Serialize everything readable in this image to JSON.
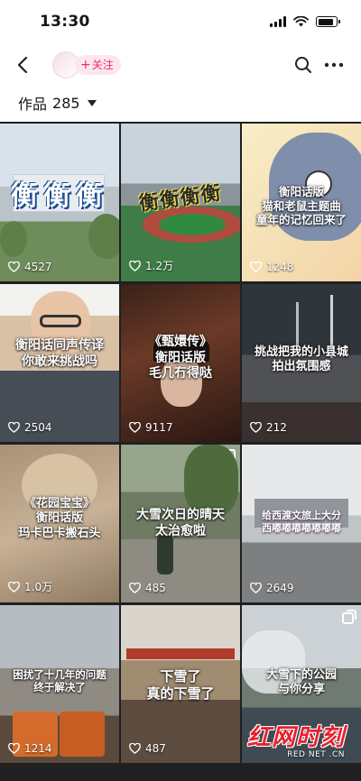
{
  "status_bar": {
    "time": "13:30"
  },
  "nav": {
    "follow_label": "关注"
  },
  "works": {
    "label": "作品",
    "count": "285"
  },
  "tiles": [
    {
      "overlay": "衡衡衡",
      "caption": "",
      "likes": "4527",
      "pinned": false
    },
    {
      "overlay": "衡衡衡衡",
      "caption": "",
      "likes": "1.2万",
      "pinned": false
    },
    {
      "overlay": "",
      "caption": "衡阳话版\n猫和老鼠主题曲\n童年的记忆回来了",
      "likes": "1248",
      "pinned": false
    },
    {
      "overlay": "",
      "caption": "衡阳话同声传译\n你敢来挑战吗",
      "likes": "2504",
      "pinned": false
    },
    {
      "overlay": "",
      "caption": "《甄嬛传》\n衡阳话版\n毛几冇得哒",
      "likes": "9117",
      "pinned": false
    },
    {
      "overlay": "",
      "caption": "挑战把我的小县城\n拍出氛围感",
      "likes": "212",
      "pinned": false
    },
    {
      "overlay": "",
      "caption": "《花园宝宝》\n衡阳话版\n玛卡巴卡搬石头",
      "likes": "1.0万",
      "pinned": false
    },
    {
      "overlay": "",
      "caption": "大雪次日的晴天\n太治愈啦",
      "likes": "485",
      "pinned": true
    },
    {
      "overlay": "",
      "caption": "给西渡文旅上大分\n西嘟嘟嘟嘟嘟嘟嘟",
      "likes": "2649",
      "pinned": false
    },
    {
      "overlay": "",
      "caption": "困扰了十几年的问题\n终于解决了",
      "likes": "1214",
      "pinned": false
    },
    {
      "overlay": "",
      "caption": "下雪了\n真的下雪了",
      "likes": "487",
      "pinned": false
    },
    {
      "overlay": "",
      "caption": "大雪下的公园\n与你分享",
      "likes": "",
      "pinned": true
    }
  ],
  "watermark": {
    "brand": "红网时刻",
    "url": "RED NET .CN"
  },
  "colors": {
    "accent": "#ee2c6a",
    "follow_bg": "#fde7ee",
    "grid_bg": "#202020",
    "brand_red": "#e8212e"
  },
  "icons": {
    "back": "chevron-left-icon",
    "search": "search-icon",
    "more": "more-dots-icon",
    "heart": "heart-outline-icon",
    "pin": "multi-image-icon"
  }
}
